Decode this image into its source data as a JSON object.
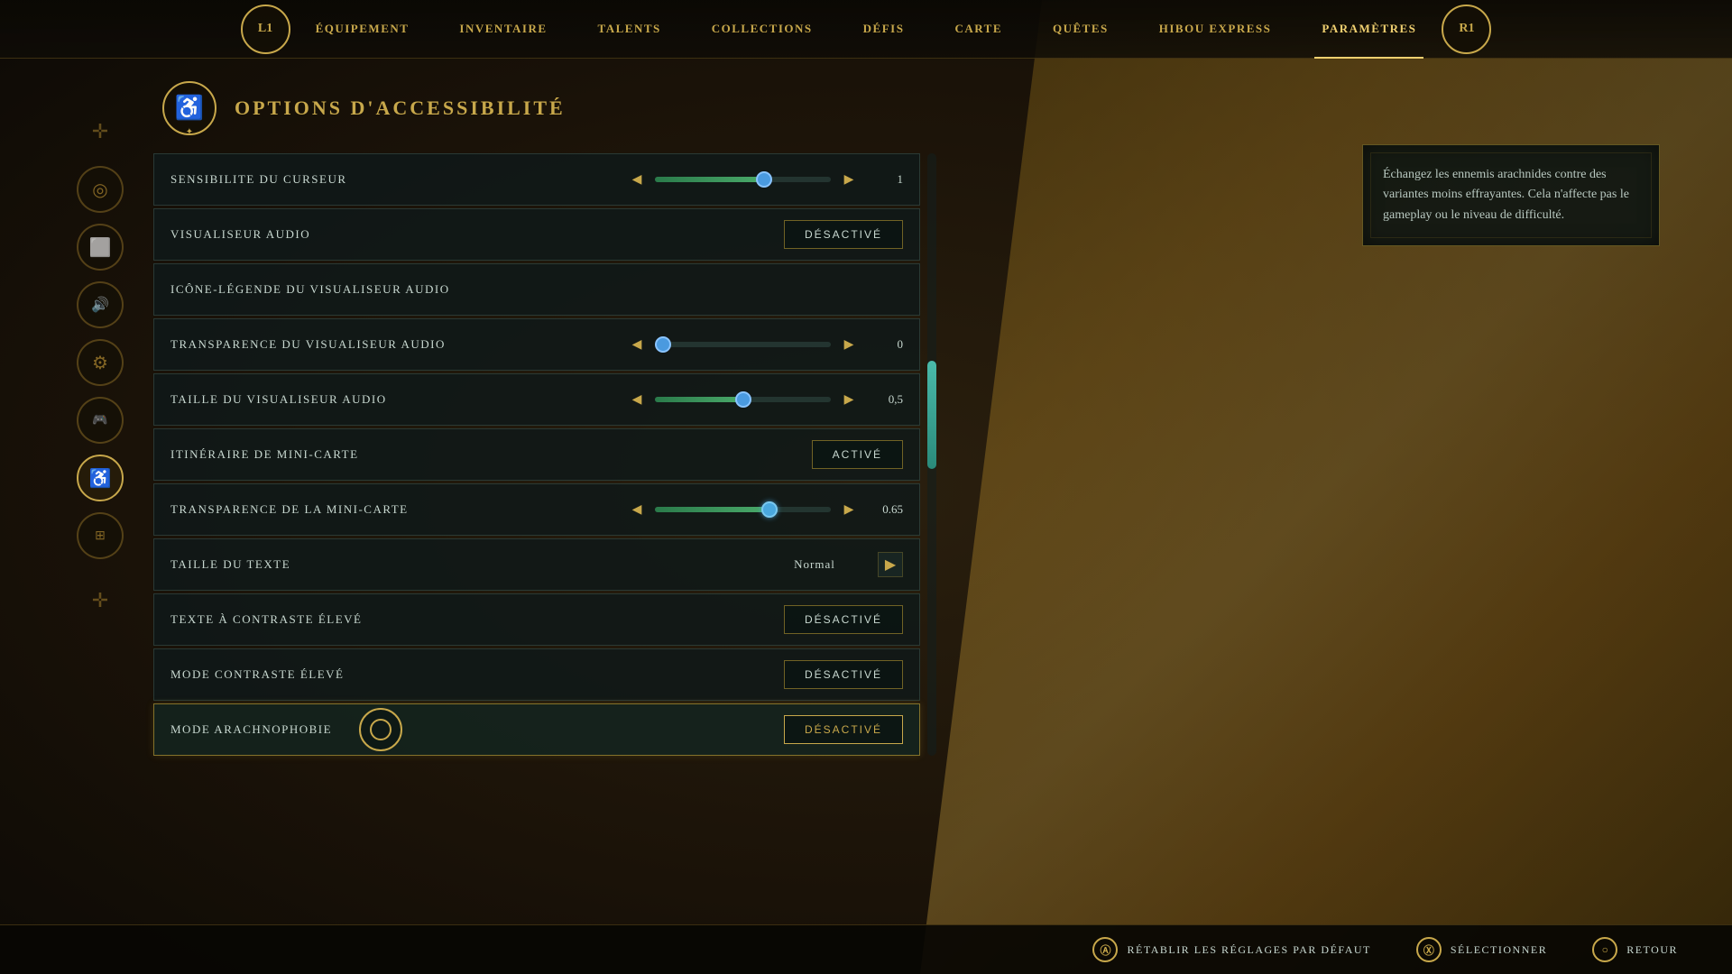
{
  "nav": {
    "left_btn": "L1",
    "right_btn": "R1",
    "items": [
      {
        "id": "equipement",
        "label": "ÉQUIPEMENT",
        "active": false
      },
      {
        "id": "inventaire",
        "label": "INVENTAIRE",
        "active": false
      },
      {
        "id": "talents",
        "label": "TALENTS",
        "active": false
      },
      {
        "id": "collections",
        "label": "COLLECTIONS",
        "active": false
      },
      {
        "id": "defis",
        "label": "DÉFIS",
        "active": false
      },
      {
        "id": "carte",
        "label": "CARTE",
        "active": false
      },
      {
        "id": "quetes",
        "label": "QUÊTES",
        "active": false
      },
      {
        "id": "hibou",
        "label": "HIBOU EXPRESS",
        "active": false
      },
      {
        "id": "parametres",
        "label": "PARAMÈTRES",
        "active": true
      }
    ]
  },
  "sidebar": {
    "icons": [
      {
        "id": "crosshair",
        "symbol": "✛",
        "active": false
      },
      {
        "id": "disc",
        "symbol": "◎",
        "active": false
      },
      {
        "id": "display",
        "symbol": "⊡",
        "active": false
      },
      {
        "id": "sound",
        "symbol": "◁))",
        "active": false
      },
      {
        "id": "gear",
        "symbol": "⚙",
        "active": false
      },
      {
        "id": "gamepad",
        "symbol": "⊡",
        "active": false
      },
      {
        "id": "accessibility",
        "symbol": "♿",
        "active": true
      },
      {
        "id": "network",
        "symbol": "⊞",
        "active": false
      }
    ],
    "bottom_cross": "✛"
  },
  "page": {
    "title": "OPTIONS D'ACCESSIBILITÉ",
    "title_icon": "♿"
  },
  "settings": [
    {
      "id": "sensibilite-curseur",
      "label": "SENSIBILITE DU CURSEUR",
      "type": "slider",
      "fill_pct": 62,
      "thumb_pct": 62,
      "value": "1",
      "thumb_color": "#4a9adf"
    },
    {
      "id": "visualiseur-audio",
      "label": "VISUALISEUR AUDIO",
      "type": "toggle",
      "value": "DÉSACTIVÉ"
    },
    {
      "id": "icone-legende",
      "label": "ICÔNE-LÉGENDE DU VISUALISEUR AUDIO",
      "type": "none"
    },
    {
      "id": "transparence-visualiseur",
      "label": "TRANSPARENCE DU VISUALISEUR AUDIO",
      "type": "slider",
      "fill_pct": 0,
      "thumb_pct": 0,
      "value": "0",
      "thumb_color": "#4a9adf"
    },
    {
      "id": "taille-visualiseur",
      "label": "TAILLE DU VISUALISEUR AUDIO",
      "type": "slider",
      "fill_pct": 50,
      "thumb_pct": 50,
      "value": "0,5",
      "thumb_color": "#4a9adf"
    },
    {
      "id": "itineraire-mini-carte",
      "label": "ITINÉRAIRE DE MINI-CARTE",
      "type": "toggle",
      "value": "ACTIVÉ"
    },
    {
      "id": "transparence-mini-carte",
      "label": "TRANSPARENCE DE LA MINI-CARTE",
      "type": "slider",
      "fill_pct": 65,
      "thumb_pct": 65,
      "value": "0.65",
      "thumb_color": "#4aa8df"
    },
    {
      "id": "taille-texte",
      "label": "TAILLE DU TEXTE",
      "type": "select",
      "value": "Normal"
    },
    {
      "id": "texte-contraste-eleve",
      "label": "TEXTE À CONTRASTE ÉLEVÉ",
      "type": "toggle",
      "value": "DÉSACTIVÉ"
    },
    {
      "id": "mode-contraste-eleve",
      "label": "MODE CONTRASTE ÉLEVÉ",
      "type": "toggle",
      "value": "DÉSACTIVÉ"
    },
    {
      "id": "mode-arachnophobie",
      "label": "MODE ARACHNOPHOBIE",
      "type": "toggle-active",
      "value": "DÉSACTIVÉ"
    }
  ],
  "info_panel": {
    "text": "Échangez les ennemis arachnides contre des variantes moins effrayantes. Cela n'affecte pas le gameplay ou le niveau de difficulté."
  },
  "bottom_bar": {
    "actions": [
      {
        "id": "reset",
        "icon": "Ⓐ",
        "label": "RÉTABLIR LES RÉGLAGES PAR DÉFAUT"
      },
      {
        "id": "select",
        "icon": "Ⓧ",
        "label": "SÉLECTIONNER"
      },
      {
        "id": "back",
        "icon": "○",
        "label": "RETOUR"
      }
    ]
  }
}
